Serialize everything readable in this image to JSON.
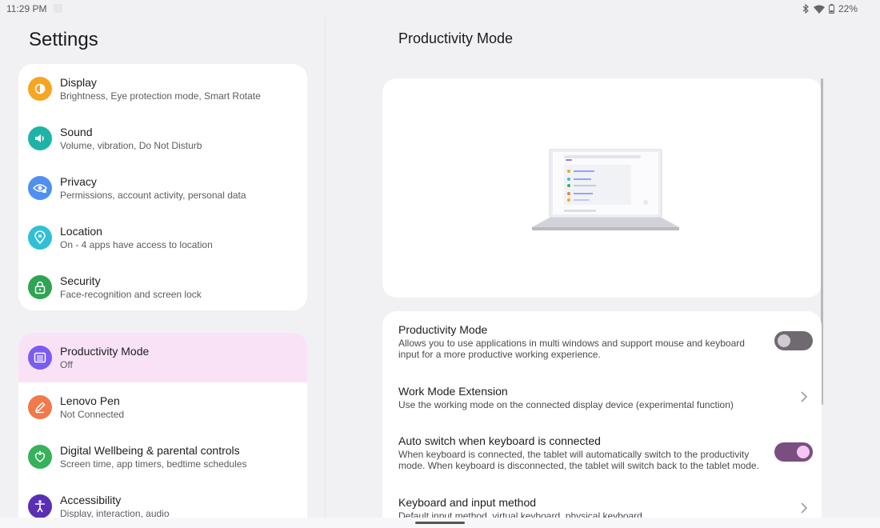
{
  "status": {
    "time": "11:29 PM",
    "battery": "22%",
    "icons": [
      "bluetooth-icon",
      "wifi-icon",
      "battery-icon"
    ]
  },
  "left": {
    "title": "Settings",
    "group1": [
      {
        "title": "Display",
        "subtitle": "Brightness, Eye protection mode, Smart Rotate",
        "icon": "brightness-icon",
        "color": "#f6a623"
      },
      {
        "title": "Sound",
        "subtitle": "Volume, vibration, Do Not Disturb",
        "icon": "speaker-icon",
        "color": "#1fb3a7"
      },
      {
        "title": "Privacy",
        "subtitle": "Permissions, account activity, personal data",
        "icon": "eye-lock-icon",
        "color": "#4f8ff0"
      },
      {
        "title": "Location",
        "subtitle": "On - 4 apps have access to location",
        "icon": "location-pin-icon",
        "color": "#2fc0d6"
      },
      {
        "title": "Security",
        "subtitle": "Face-recognition and screen lock",
        "icon": "lock-icon",
        "color": "#2da553"
      }
    ],
    "group2": [
      {
        "title": "Productivity Mode",
        "subtitle": "Off",
        "icon": "productivity-icon",
        "color": "#7a5cf0",
        "selected": true
      },
      {
        "title": "Lenovo Pen",
        "subtitle": "Not Connected",
        "icon": "pen-icon",
        "color": "#f07a4a"
      },
      {
        "title": "Digital Wellbeing & parental controls",
        "subtitle": "Screen time, app timers, bedtime schedules",
        "icon": "wellbeing-icon",
        "color": "#35b25a"
      },
      {
        "title": "Accessibility",
        "subtitle": "Display, interaction, audio",
        "icon": "accessibility-icon",
        "color": "#5a2fb5"
      }
    ]
  },
  "right": {
    "title": "Productivity Mode",
    "options": [
      {
        "title": "Productivity Mode",
        "desc": "Allows you to use applications in multi windows and support mouse and keyboard input for a more productive working experience.",
        "control": "toggle",
        "state": "off"
      },
      {
        "title": "Work Mode Extension",
        "desc": "Use the working mode on the connected display device (experimental function)",
        "control": "chevron"
      },
      {
        "title": "Auto switch when keyboard is connected",
        "desc": "When keyboard is connected, the tablet will automatically switch to the productivity mode. When keyboard is disconnected, the tablet will switch back to the tablet mode.",
        "control": "toggle",
        "state": "on"
      },
      {
        "title": "Keyboard and input method",
        "desc": "Default input method, virtual keyboard, physical keyboard",
        "control": "chevron"
      }
    ]
  }
}
